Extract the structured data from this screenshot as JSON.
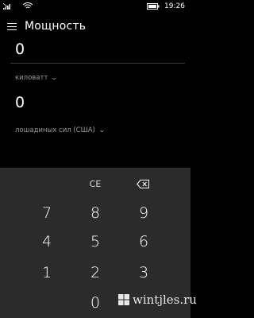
{
  "status": {
    "time": "19:26"
  },
  "app": {
    "title": "Мощность"
  },
  "converter": {
    "top_value": "0",
    "top_unit": "киловатт",
    "bottom_value": "0",
    "bottom_unit": "лошадиных сил (США)"
  },
  "keypad": {
    "ce": "CE",
    "k7": "7",
    "k8": "8",
    "k9": "9",
    "k4": "4",
    "k5": "5",
    "k6": "6",
    "k1": "1",
    "k2": "2",
    "k3": "3",
    "k0": "0"
  },
  "watermark": {
    "text": "wintjles.ru"
  },
  "colors": {
    "background": "#000000",
    "keypad": "#2b2b2b",
    "muted_text": "#9a9a9a"
  }
}
